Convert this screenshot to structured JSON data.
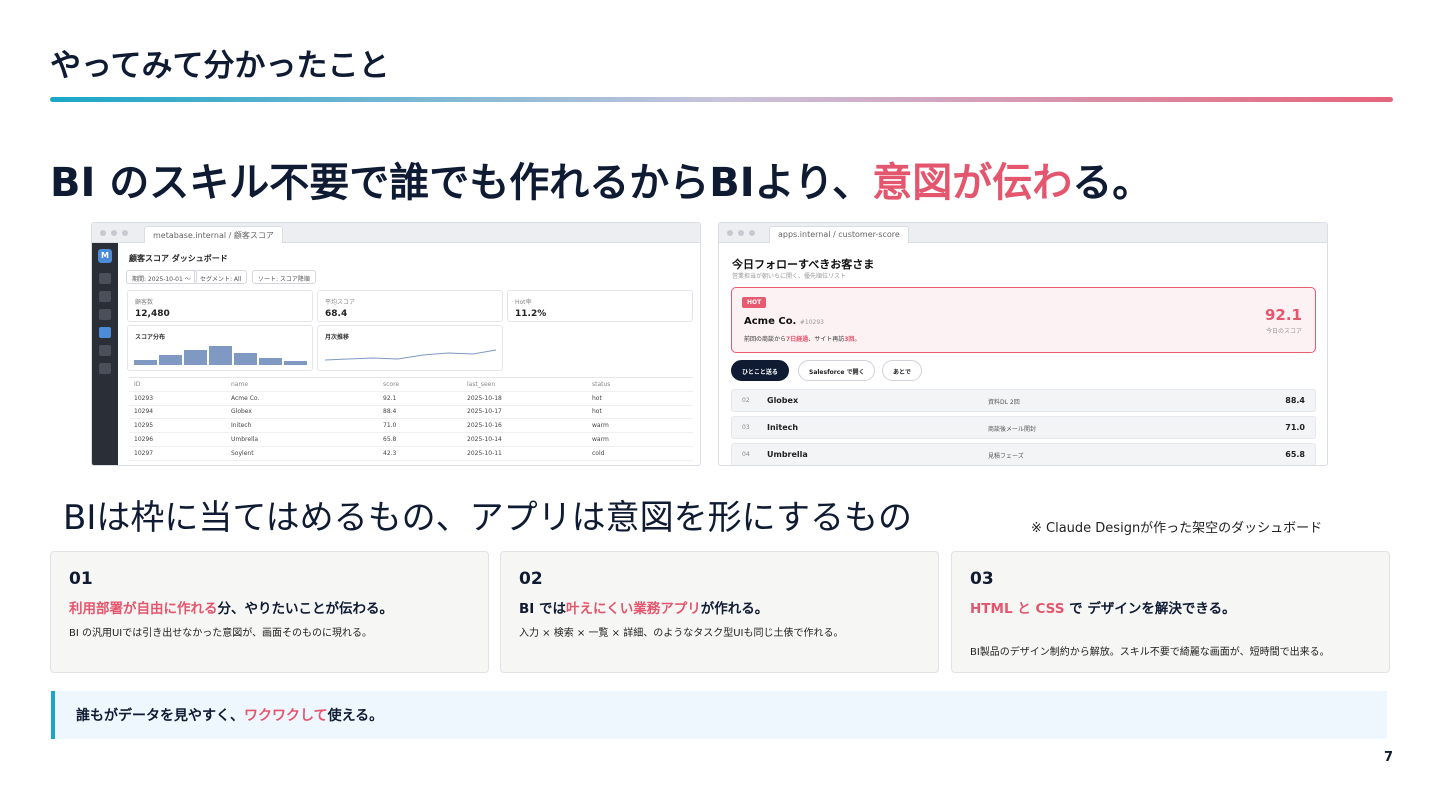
{
  "slide": {
    "title": "やってみて分かったこと",
    "headline_pre": "BI のスキル不要で誰でも作れるからBIより、",
    "headline_hl": "意図が伝わ",
    "headline_post": "る。",
    "subheadline": "BIは枠に当てはめるもの、アプリは意図を形にするもの",
    "note": "※ Claude Designが作った架空のダッシュボード",
    "page_number": "7",
    "accent_color": "#e4566e"
  },
  "metabase": {
    "url": "metabase.internal / 顧客スコア",
    "logo": "M",
    "title": "顧客スコア ダッシュボード",
    "filters": [
      "期間: 2025-10-01 〜",
      "セグメント: All",
      "ソート: スコア降順"
    ],
    "kpis": [
      {
        "label": "顧客数",
        "value": "12,480"
      },
      {
        "label": "平均スコア",
        "value": "68.4"
      },
      {
        "label": "Hot率",
        "value": "11.2%"
      }
    ],
    "hist_title": "スコア分布",
    "hist_values": [
      0.25,
      0.45,
      0.7,
      0.85,
      0.55,
      0.32,
      0.18
    ],
    "trend_title": "月次推移",
    "table_headers": [
      "ID",
      "name",
      "score",
      "last_seen",
      "status"
    ],
    "rows": [
      [
        "10293",
        "Acme Co.",
        "92.1",
        "2025-10-18",
        "hot"
      ],
      [
        "10294",
        "Globex",
        "88.4",
        "2025-10-17",
        "hot"
      ],
      [
        "10295",
        "Initech",
        "71.0",
        "2025-10-16",
        "warm"
      ],
      [
        "10296",
        "Umbrella",
        "65.8",
        "2025-10-14",
        "warm"
      ],
      [
        "10297",
        "Soylent",
        "42.3",
        "2025-10-11",
        "cold"
      ]
    ]
  },
  "app": {
    "url": "apps.internal / customer-score",
    "title": "今日フォローすべきお客さま",
    "subtitle": "営業担当が朝いちに開く、優先順位リスト",
    "hot_badge": "HOT",
    "hot_name": "Acme Co.",
    "hot_id": "#10293",
    "hot_note_1": "前回の商談から",
    "hot_note_hl1": "7日経過",
    "hot_note_2": "、サイト再訪",
    "hot_note_hl2": "3回",
    "hot_note_3": "。",
    "hot_score": "92.1",
    "hot_score_label": "今日のスコア",
    "buttons": [
      "ひとこと送る",
      "Salesforce で開く",
      "あとで"
    ],
    "list": [
      {
        "rank": "02",
        "name": "Globex",
        "note": "資料DL 2回",
        "score": "88.4"
      },
      {
        "rank": "03",
        "name": "Initech",
        "note": "商談後メール開封",
        "score": "71.0"
      },
      {
        "rank": "04",
        "name": "Umbrella",
        "note": "見積フェーズ",
        "score": "65.8"
      }
    ]
  },
  "cards": [
    {
      "num": "01",
      "hl": "利用部署が自由に作れる",
      "rest": "分、やりたいことが伝わる。",
      "body": "BI の汎用UIでは引き出せなかった意図が、画面そのものに現れる。"
    },
    {
      "num": "02",
      "pre": "BI では",
      "hl": "叶えにくい業務アプリ",
      "rest": "が作れる。",
      "body": "入力 × 検索 × 一覧 × 詳細、のようなタスク型UIも同じ土俵で作れる。"
    },
    {
      "num": "03",
      "hl": "HTML と CSS",
      "rest": " で デザインを解決できる。",
      "body": "BI製品のデザイン制約から解放。スキル不要で綺麗な画面が、短時間で出来る。"
    }
  ],
  "callout": {
    "pre": "誰もがデータを見やすく、",
    "hl": "ワクワクして",
    "post": "使える。"
  }
}
